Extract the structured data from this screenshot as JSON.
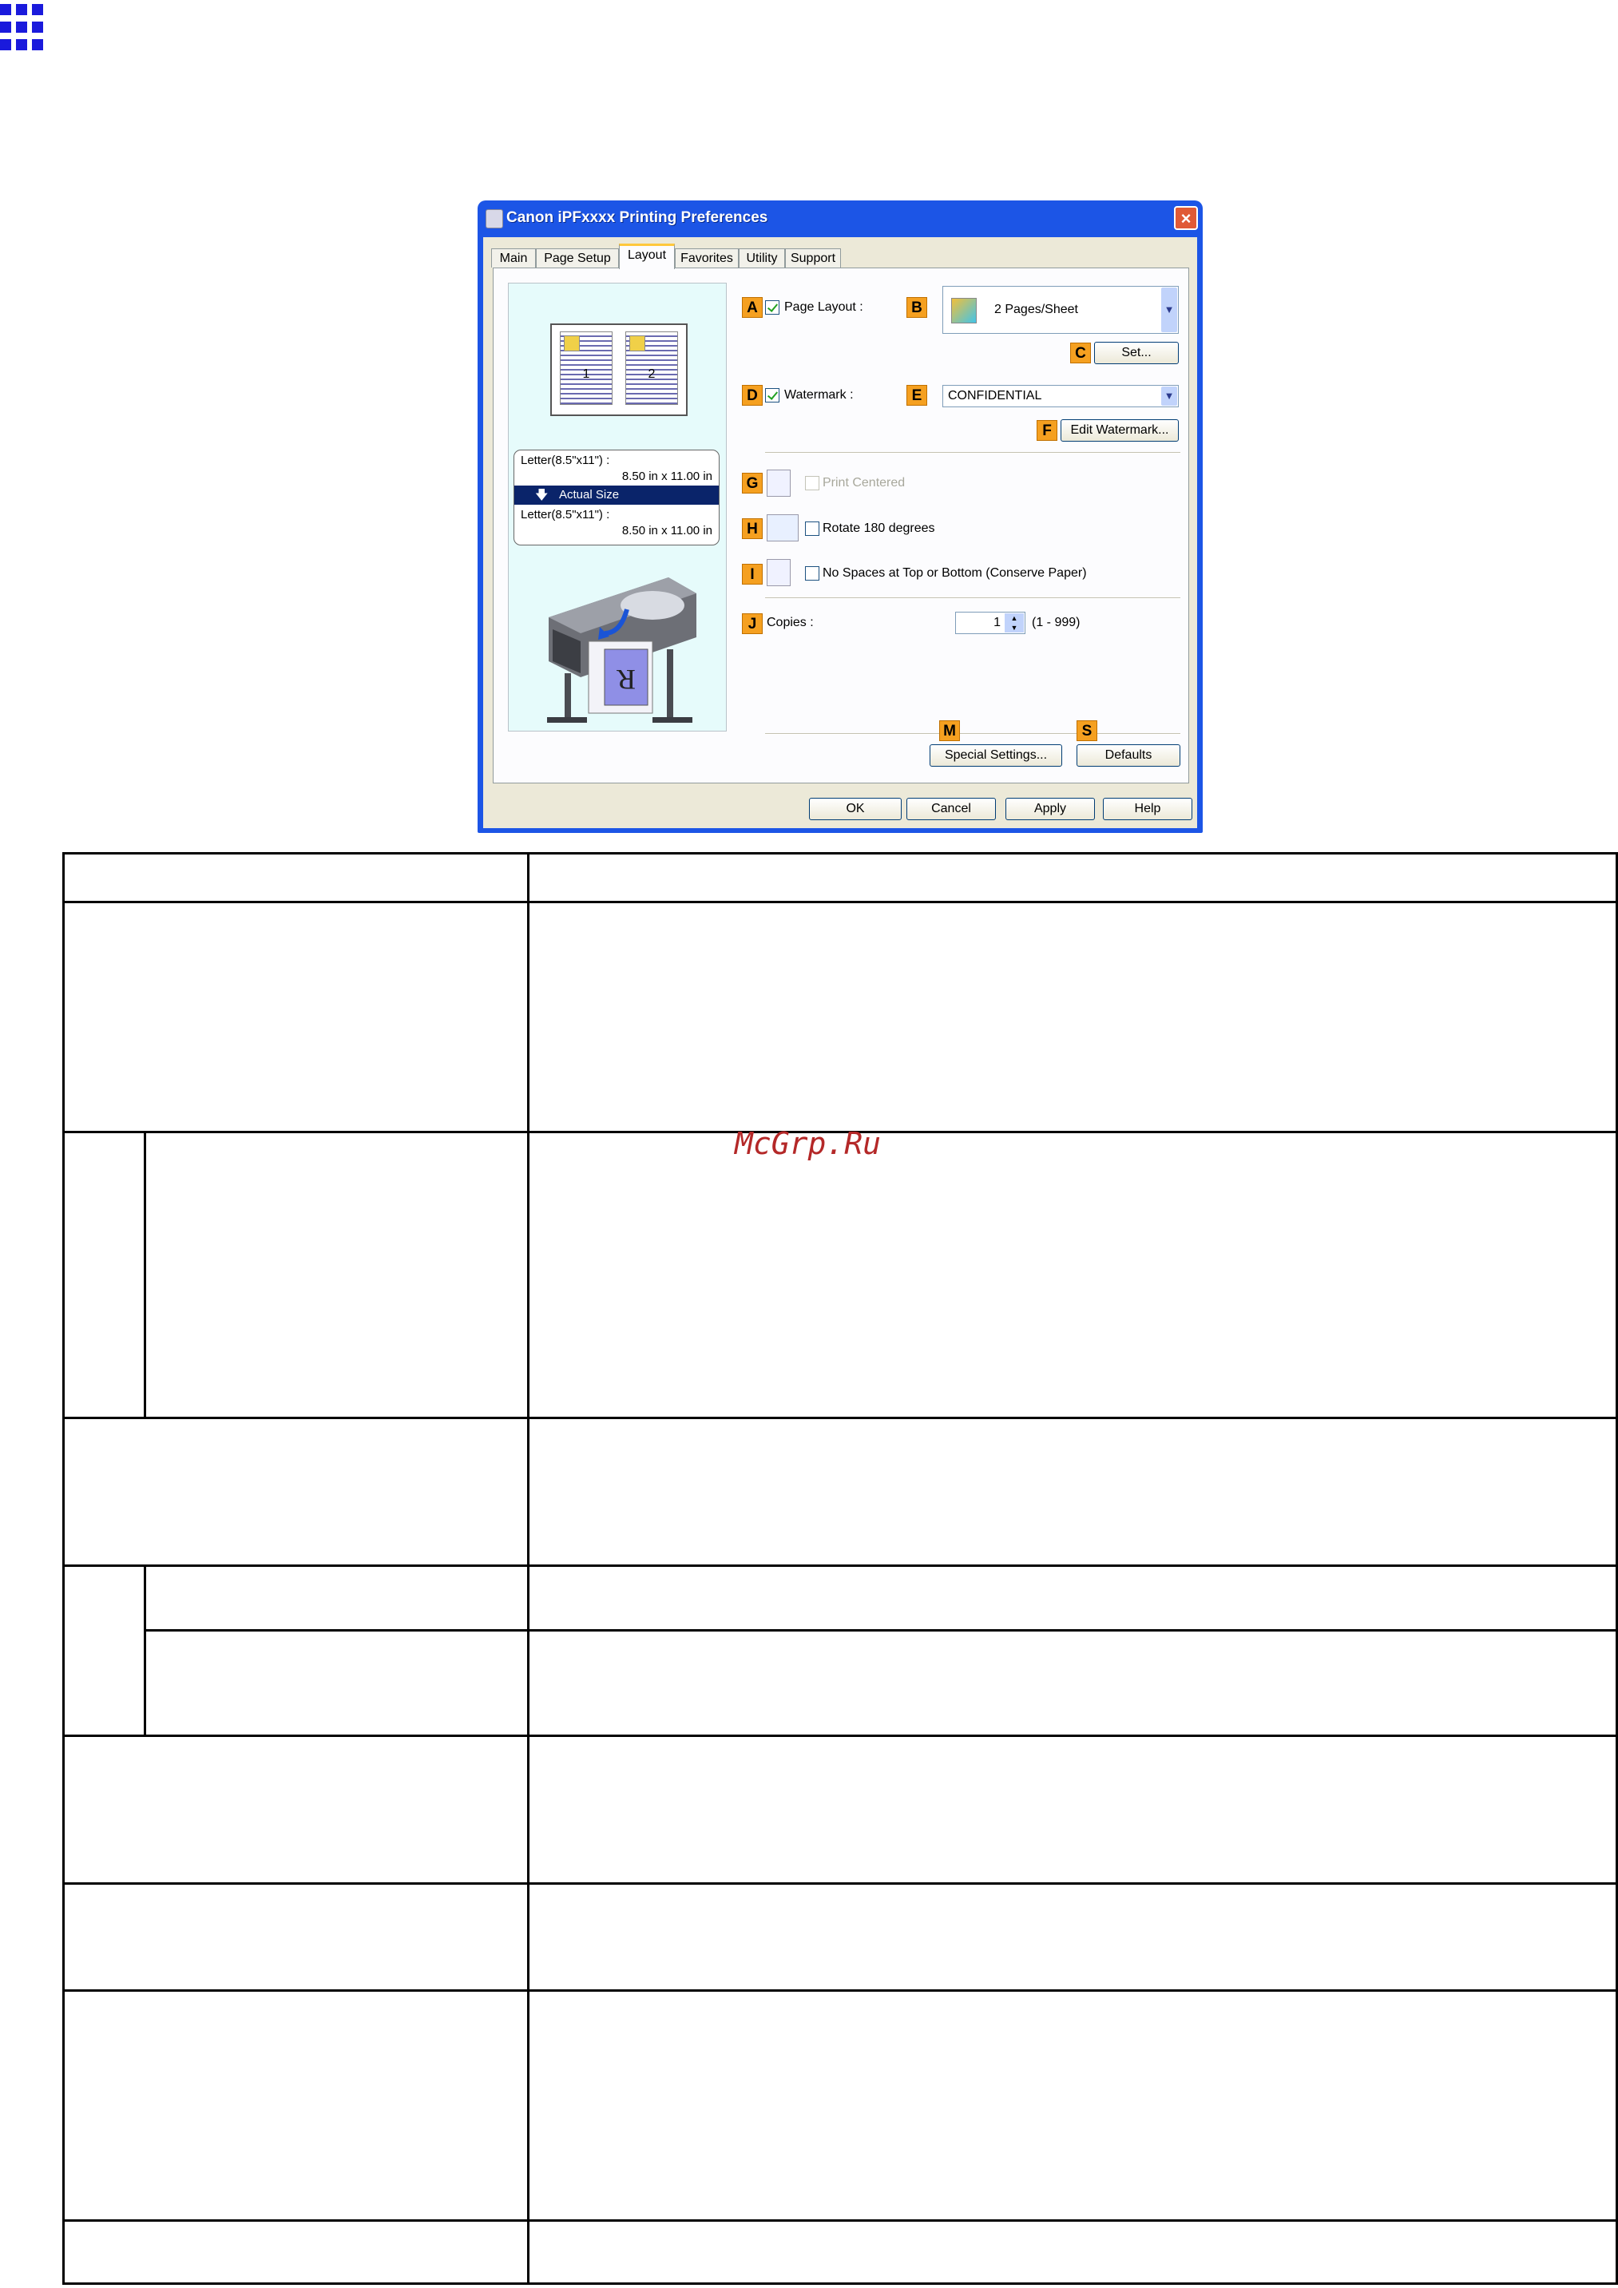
{
  "page": {
    "watermark": "McGrp.Ru"
  },
  "dialog": {
    "title": "Canon iPFxxxx Printing Preferences",
    "close_glyph": "×",
    "tabs": [
      "Main",
      "Page Setup",
      "Layout",
      "Favorites",
      "Utility",
      "Support"
    ],
    "active_tab": "Layout",
    "preview": {
      "page_numbers": [
        "1",
        "2"
      ],
      "original_size": "Letter(8.5\"x11\") :",
      "original_dims": "8.50 in x 11.00 in",
      "scale": "Actual Size",
      "output_size": "Letter(8.5\"x11\") :",
      "output_dims": "8.50 in x 11.00 in"
    },
    "controls": {
      "A": {
        "badge": "A",
        "label": "Page Layout :",
        "checked": true
      },
      "B": {
        "badge": "B",
        "value": "2 Pages/Sheet"
      },
      "C": {
        "badge": "C",
        "label": "Set..."
      },
      "D": {
        "badge": "D",
        "label": "Watermark :",
        "checked": true
      },
      "E": {
        "badge": "E",
        "value": "CONFIDENTIAL"
      },
      "F": {
        "badge": "F",
        "label": "Edit Watermark..."
      },
      "G": {
        "badge": "G",
        "label": "Print Centered",
        "checked": false,
        "disabled": true
      },
      "H": {
        "badge": "H",
        "label": "Rotate 180 degrees",
        "checked": false
      },
      "I": {
        "badge": "I",
        "label": "No Spaces at Top or Bottom (Conserve Paper)",
        "checked": false
      },
      "J": {
        "badge": "J",
        "label": "Copies :",
        "value": "1",
        "range": "(1 - 999)"
      },
      "M": {
        "badge": "M",
        "label": "Special Settings..."
      },
      "S": {
        "badge": "S",
        "label": "Defaults"
      }
    },
    "footer_buttons": {
      "ok": "OK",
      "cancel": "Cancel",
      "apply": "Apply",
      "help": "Help"
    }
  },
  "colors": {
    "badge": "#f5a020",
    "title_bar": "#1c55e6",
    "active_tab_accent": "#ffc83c"
  }
}
